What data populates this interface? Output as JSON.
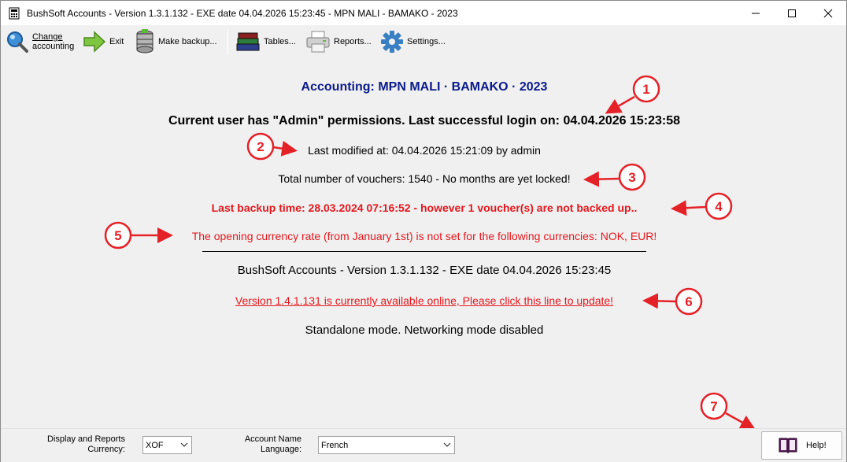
{
  "window": {
    "title": "BushSoft Accounts - Version 1.3.1.132 - EXE date 04.04.2026 15:23:45 - MPN MALI - BAMAKO  - 2023",
    "minimize_icon": "minimize-icon",
    "maximize_icon": "maximize-icon",
    "close_icon": "close-icon"
  },
  "toolbar": {
    "change_accounting_line1": "Change",
    "change_accounting_line2": "accounting",
    "exit": "Exit",
    "make_backup": "Make backup...",
    "tables": "Tables...",
    "reports": "Reports...",
    "settings": "Settings..."
  },
  "main": {
    "accounting_title": "Accounting: MPN MALI · BAMAKO  · 2023",
    "user_line": "Current user has \"Admin\" permissions. Last successful login on: 04.04.2026 15:23:58",
    "last_modified": "Last modified at: 04.04.2026 15:21:09 by admin",
    "vouchers": "Total number of vouchers: 1540 - No months are yet locked!",
    "backup": "Last backup time: 28.03.2024 07:16:52 - however 1 voucher(s) are not backed up..",
    "currency_warning": "The opening currency rate (from January 1st) is not set for the following currencies: NOK, EUR!",
    "version": "BushSoft Accounts - Version 1.3.1.132 - EXE date 04.04.2026 15:23:45",
    "update_link": "Version 1.4.1.131 is currently available online, Please click this line to update!",
    "mode": "Standalone mode. Networking mode disabled"
  },
  "annotations": [
    "1",
    "2",
    "3",
    "4",
    "5",
    "6",
    "7"
  ],
  "bottom": {
    "currency_label_line1": "Display and Reports",
    "currency_label_line2": "Currency:",
    "currency_value": "XOF",
    "language_label_line1": "Account Name",
    "language_label_line2": "Language:",
    "language_value": "French",
    "help": "Help!"
  },
  "colors": {
    "accent_blue": "#0b1b8a",
    "warning_red": "#e4181e",
    "annotation_red": "#e52128"
  }
}
